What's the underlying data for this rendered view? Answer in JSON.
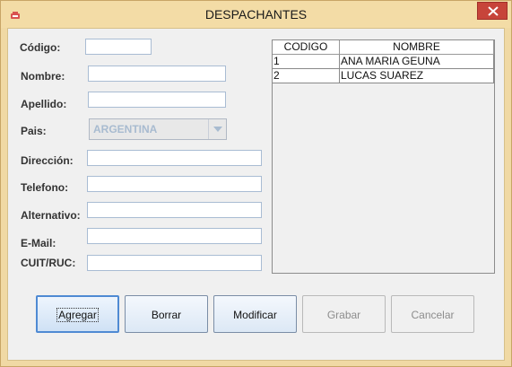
{
  "window": {
    "title": "DESPACHANTES",
    "colors": {
      "frame": "#f0d9a4",
      "close": "#c7443a",
      "client": "#f0f0f0"
    }
  },
  "form": {
    "codigo": {
      "label": "Código:",
      "value": ""
    },
    "nombre": {
      "label": "Nombre:",
      "value": ""
    },
    "apellido": {
      "label": "Apellido:",
      "value": ""
    },
    "pais": {
      "label": "Pais:",
      "value": "ARGENTINA"
    },
    "direccion": {
      "label": "Dirección:",
      "value": ""
    },
    "telefono": {
      "label": "Telefono:",
      "value": ""
    },
    "alternativo": {
      "label": "Alternativo:",
      "value": ""
    },
    "email": {
      "label": "E-Mail:",
      "value": ""
    },
    "cuit": {
      "label": "CUIT/RUC:",
      "value": ""
    }
  },
  "table": {
    "columns": [
      "CODIGO",
      "NOMBRE"
    ],
    "rows": [
      [
        "1",
        "ANA MARIA GEUNA"
      ],
      [
        "2",
        "LUCAS SUAREZ"
      ]
    ]
  },
  "buttons": {
    "agregar": "Agregar",
    "borrar": "Borrar",
    "modificar": "Modificar",
    "grabar": "Grabar",
    "cancelar": "Cancelar"
  },
  "icons": {
    "app": "java-cup-icon",
    "close": "close-icon",
    "combo": "chevron-down-icon"
  }
}
